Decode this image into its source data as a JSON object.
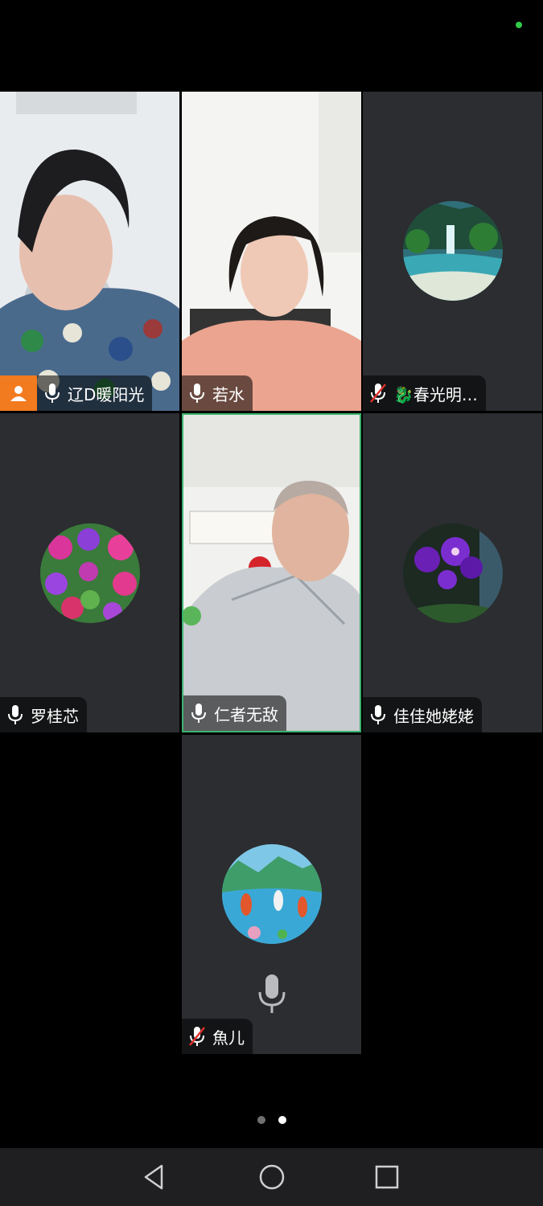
{
  "colors": {
    "status_dot": "#31c94a",
    "active_border": "#3cb46e",
    "host_badge": "#f27a1f",
    "muted_slash": "#e0312c",
    "page_dot_inactive": "#6f6f6f",
    "page_dot_active": "#ffffff"
  },
  "participants": [
    {
      "name": "辽D暖阳光",
      "mic": "on",
      "host": true,
      "video": true
    },
    {
      "name": "若水",
      "mic": "on",
      "video": true
    },
    {
      "name": "🐉春光明…",
      "mic": "muted",
      "video": false,
      "avatar": "waterfall-landscape"
    },
    {
      "name": "罗桂芯",
      "mic": "on",
      "video": false,
      "avatar": "flowers"
    },
    {
      "name": "仁者无敌",
      "mic": "on",
      "video": true,
      "active_speaker": true
    },
    {
      "name": "佳佳她姥姥",
      "mic": "on",
      "video": false,
      "avatar": "purple-orchid"
    },
    {
      "name": "魚儿",
      "mic": "muted",
      "video": false,
      "avatar": "koi-pond"
    }
  ],
  "pager": {
    "pages": 2,
    "current": 2
  },
  "navbar": [
    "back-icon",
    "home-icon",
    "recents-icon"
  ]
}
